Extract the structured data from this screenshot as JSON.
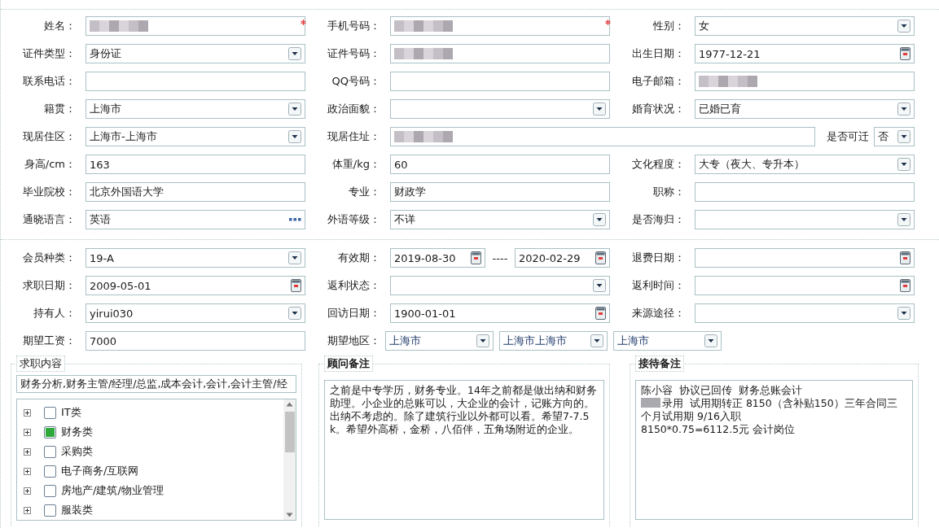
{
  "section_1": {
    "rows": [
      [
        {
          "label": "姓名：",
          "kind": "text",
          "redacted": true,
          "required": true
        },
        {
          "label": "手机号码：",
          "kind": "text",
          "redacted": true,
          "required": true
        },
        {
          "label": "性别：",
          "kind": "select",
          "value": "女"
        }
      ],
      [
        {
          "label": "证件类型：",
          "kind": "select",
          "value": "身份证"
        },
        {
          "label": "证件号码：",
          "kind": "text",
          "redacted": true
        },
        {
          "label": "出生日期：",
          "kind": "date",
          "value": "1977-12-21"
        }
      ],
      [
        {
          "label": "联系电话：",
          "kind": "text"
        },
        {
          "label": "QQ号码：",
          "kind": "text"
        },
        {
          "label": "电子邮箱：",
          "kind": "text",
          "redacted": true
        }
      ],
      [
        {
          "label": "籍贯：",
          "kind": "select",
          "value": "上海市"
        },
        {
          "label": "政治面貌：",
          "kind": "select"
        },
        {
          "label": "婚育状况：",
          "kind": "select",
          "value": "已婚已育"
        }
      ],
      [
        {
          "label": "现居住区：",
          "kind": "select",
          "value": "上海市-上海市"
        },
        {
          "label": "现居住址：",
          "kind": "address",
          "redacted": true,
          "extra": {
            "label": "是否可迁",
            "value": "否"
          }
        }
      ],
      [
        {
          "label": "身高/cm：",
          "kind": "text",
          "value": "163"
        },
        {
          "label": "体重/kg：",
          "kind": "text",
          "value": "60"
        },
        {
          "label": "文化程度：",
          "kind": "select",
          "value": "大专（夜大、专升本）"
        }
      ],
      [
        {
          "label": "毕业院校：",
          "kind": "text",
          "value": "北京外国语大学"
        },
        {
          "label": "专业：",
          "kind": "text",
          "value": "财政学"
        },
        {
          "label": "职称：",
          "kind": "text"
        }
      ],
      [
        {
          "label": "通晓语言：",
          "kind": "lookup",
          "value": "英语"
        },
        {
          "label": "外语等级：",
          "kind": "select",
          "value": "不详"
        },
        {
          "label": "是否海归：",
          "kind": "select"
        }
      ]
    ]
  },
  "section_2": {
    "rows": [
      [
        {
          "label": "会员种类：",
          "kind": "select",
          "value": "19-A"
        },
        {
          "label": "有效期：",
          "kind": "date_range",
          "values": [
            "2019-08-30",
            "2020-02-29"
          ],
          "separator": "----"
        },
        {
          "label": "退费日期：",
          "kind": "date"
        }
      ],
      [
        {
          "label": "求职日期：",
          "kind": "date",
          "value": "2009-05-01"
        },
        {
          "label": "返利状态：",
          "kind": "select"
        },
        {
          "label": "返利时间：",
          "kind": "date"
        }
      ],
      [
        {
          "label": "持有人：",
          "kind": "select",
          "value": "yirui030"
        },
        {
          "label": "回访日期：",
          "kind": "date",
          "value": "1900-01-01"
        },
        {
          "label": "来源途径：",
          "kind": "select"
        }
      ],
      [
        {
          "label": "期望工资：",
          "kind": "text",
          "value": "7000"
        },
        {
          "label": "期望地区：",
          "kind": "multi_select",
          "values": [
            "上海市",
            "上海市上海市",
            "上海市"
          ]
        }
      ]
    ]
  },
  "job_content": {
    "legend": "求职内容",
    "summary": "财务分析,财务主管/经理/总监,成本会计,会计,会计主管/经",
    "categories": [
      {
        "label": "IT类",
        "checked": false
      },
      {
        "label": "财务类",
        "checked": true
      },
      {
        "label": "采购类",
        "checked": false
      },
      {
        "label": "电子商务/互联网",
        "checked": false
      },
      {
        "label": "房地产/建筑/物业管理",
        "checked": false
      },
      {
        "label": "服装类",
        "checked": false
      }
    ]
  },
  "advisor_notes": {
    "legend": "顾问备注",
    "text": "之前是中专学历，财务专业。14年之前都是做出纳和财务助理。小企业的总账可以，大企业的会计，记账方向的。出纳不考虑的。除了建筑行业以外都可以看。希望7-7.5k。希望外高桥，金桥，八佰伴，五角场附近的企业。"
  },
  "reception_notes": {
    "legend": "接待备注",
    "lines": [
      {
        "text": "陈小容  协议已回传  财务总账会计",
        "redacted_prefix": false
      },
      {
        "text": "录用  试用期转正 8150（含补贴150）三年合同三个月试用期 9/16入职",
        "redacted_prefix": true
      },
      {
        "text": "8150*0.75=6112.5元 会计岗位",
        "redacted_prefix": false
      }
    ]
  }
}
